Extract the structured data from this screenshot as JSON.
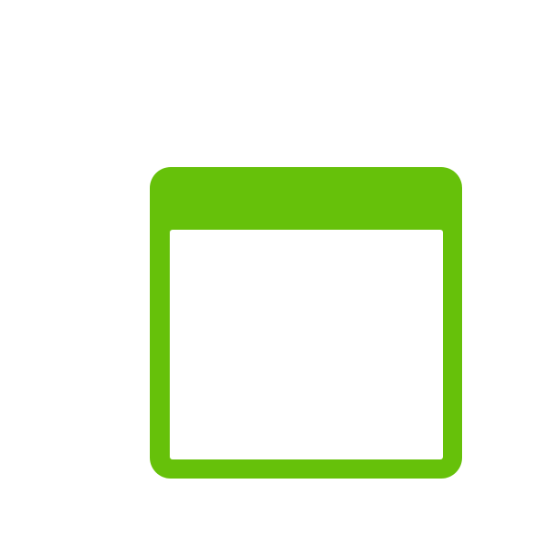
{
  "icon": {
    "name": "window-icon",
    "color": "#66C10A",
    "background": "#FFFFFF"
  }
}
